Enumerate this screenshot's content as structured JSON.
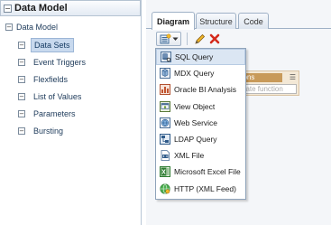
{
  "left_panel": {
    "header_title": "Data Model",
    "tree_root": "Data Model",
    "items": [
      {
        "label": "Data Sets",
        "selected": true
      },
      {
        "label": "Event Triggers",
        "selected": false
      },
      {
        "label": "Flexfields",
        "selected": false
      },
      {
        "label": "List of Values",
        "selected": false
      },
      {
        "label": "Parameters",
        "selected": false
      },
      {
        "label": "Bursting",
        "selected": false
      }
    ]
  },
  "tabs": [
    {
      "label": "Diagram",
      "active": true
    },
    {
      "label": "Structure",
      "active": false
    },
    {
      "label": "Code",
      "active": false
    }
  ],
  "toolbar": {
    "new_dataset_icon": "new-dataset-icon",
    "edit_icon": "pencil-icon",
    "delete_icon": "delete-x-icon"
  },
  "background_panel": {
    "header_fragment": "nctions",
    "input_placeholder_fragment": "gate function"
  },
  "menu": {
    "items": [
      {
        "label": "SQL Query",
        "icon": "sql-query-icon",
        "highlighted": true
      },
      {
        "label": "MDX Query",
        "icon": "mdx-query-icon",
        "highlighted": false
      },
      {
        "label": "Oracle BI Analysis",
        "icon": "oracle-bi-analysis-icon",
        "highlighted": false
      },
      {
        "label": "View Object",
        "icon": "view-object-icon",
        "highlighted": false
      },
      {
        "label": "Web Service",
        "icon": "web-service-icon",
        "highlighted": false
      },
      {
        "label": "LDAP Query",
        "icon": "ldap-query-icon",
        "highlighted": false
      },
      {
        "label": "XML File",
        "icon": "xml-file-icon",
        "highlighted": false
      },
      {
        "label": "Microsoft Excel File",
        "icon": "excel-file-icon",
        "highlighted": false
      },
      {
        "label": "HTTP (XML Feed)",
        "icon": "http-xml-feed-icon",
        "highlighted": false
      }
    ]
  },
  "colors": {
    "selection": "#c8d9ee",
    "menu_highlight": "#dbe6f3",
    "delete_red": "#d42a1c"
  }
}
